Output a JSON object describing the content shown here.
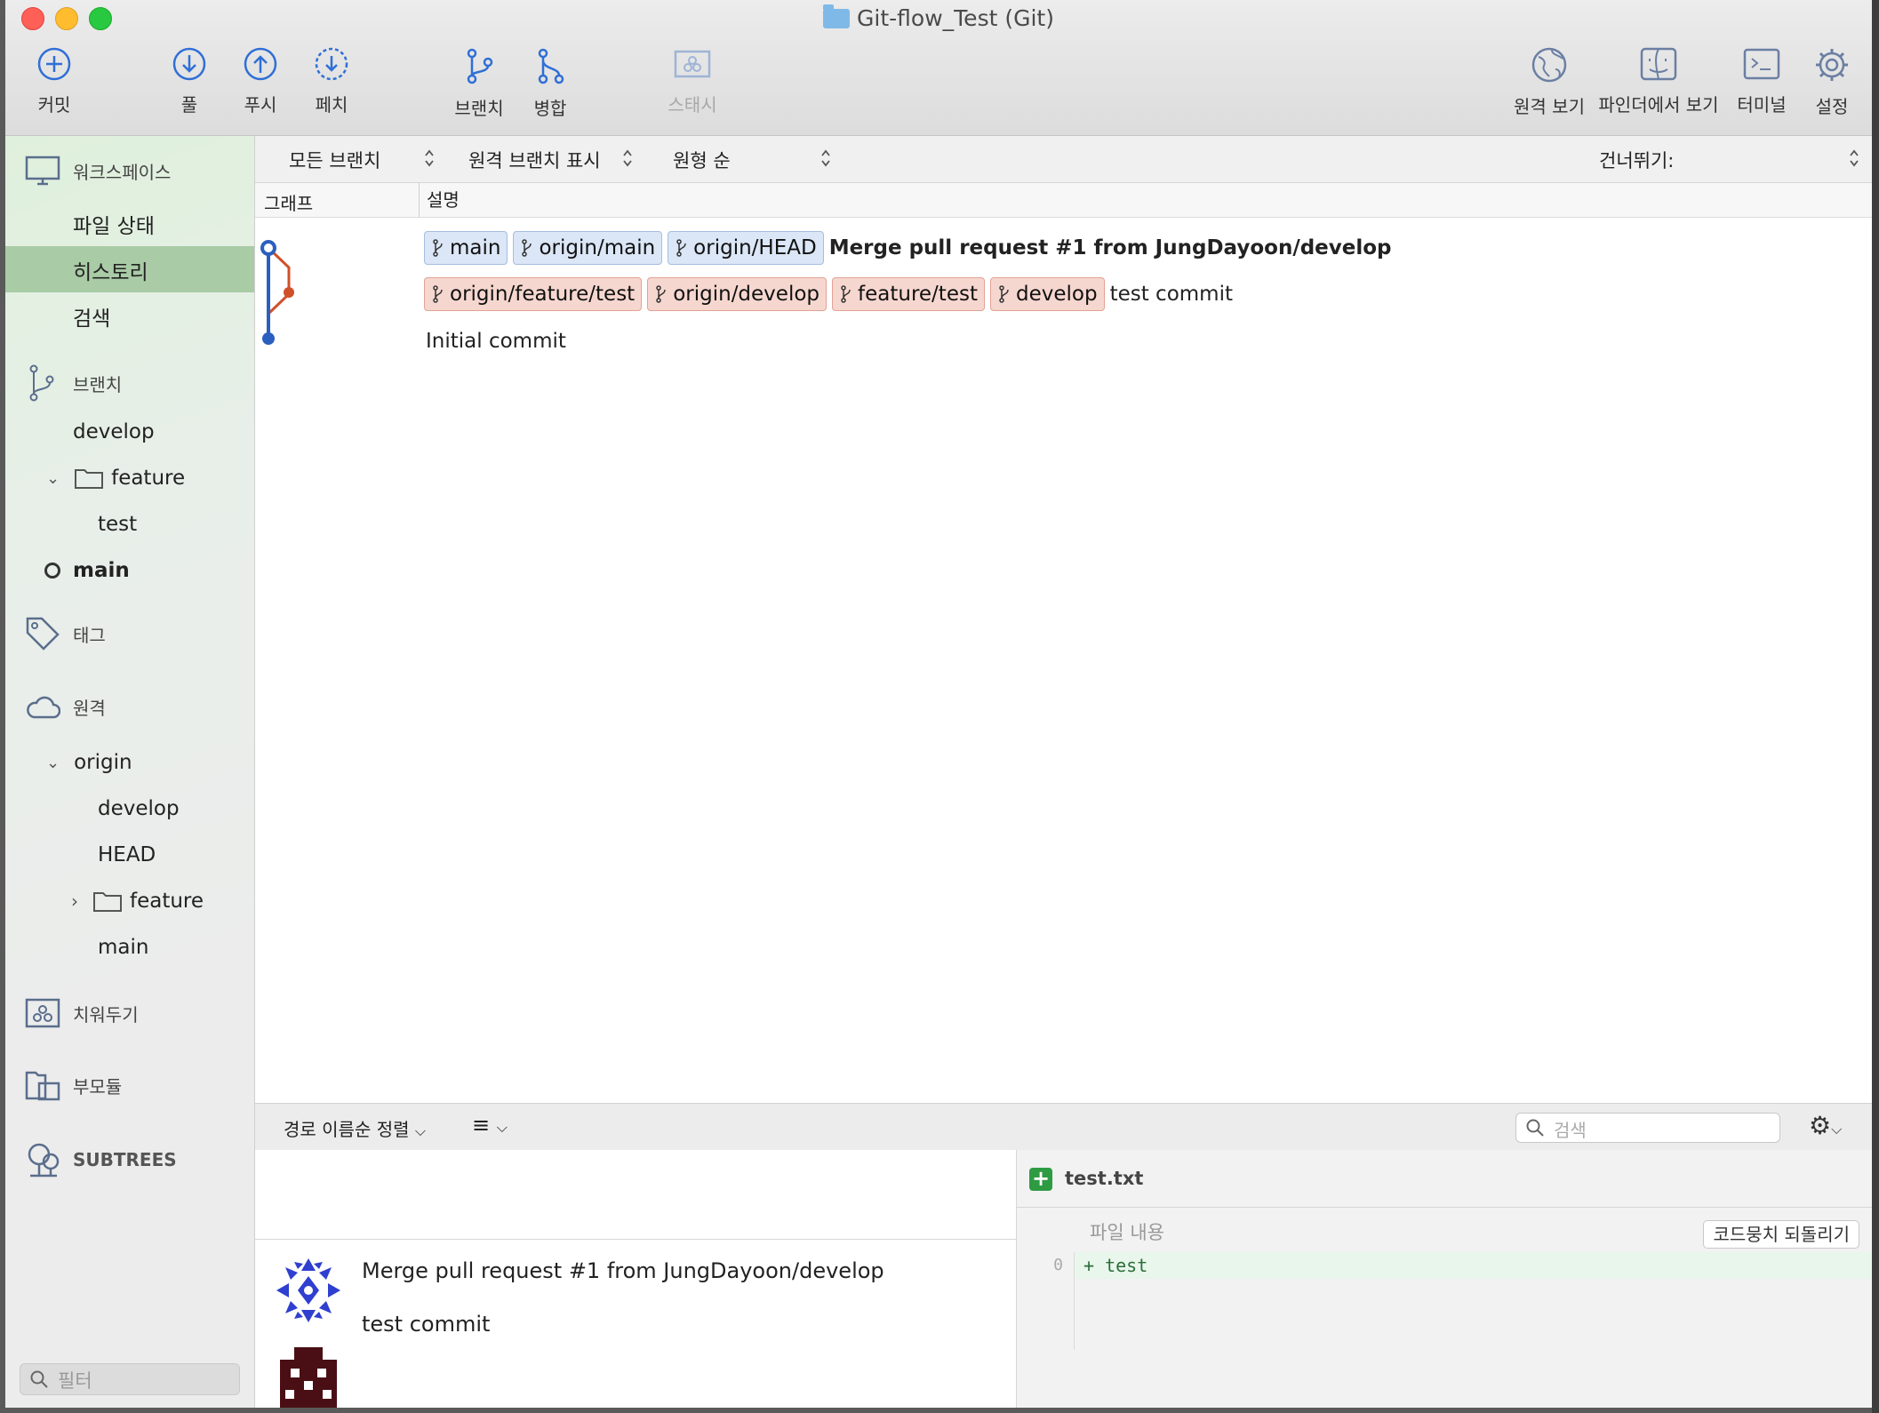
{
  "window": {
    "title": "Git-flow_Test (Git)"
  },
  "toolbar": {
    "commit": "커밋",
    "pull": "풀",
    "push": "푸시",
    "fetch": "페치",
    "branch": "브랜치",
    "merge": "병합",
    "stash": "스태시",
    "remote_view": "원격 보기",
    "finder_view": "파인더에서 보기",
    "terminal": "터미널",
    "settings": "설정"
  },
  "sidebar": {
    "workspace": {
      "title": "워크스페이스",
      "items": [
        "파일 상태",
        "히스토리",
        "검색"
      ],
      "selected": "히스토리"
    },
    "branches": {
      "title": "브랜치",
      "develop": "develop",
      "folder": "feature",
      "folder_child": "test",
      "current": "main"
    },
    "tags": {
      "title": "태그"
    },
    "remotes": {
      "title": "원격",
      "origin": "origin",
      "develop": "develop",
      "head": "HEAD",
      "folder": "feature",
      "main": "main"
    },
    "stashes": {
      "title": "치워두기"
    },
    "submodules": {
      "title": "부모듈"
    },
    "subtrees": {
      "title": "SUBTREES"
    },
    "filter_placeholder": "필터"
  },
  "filterbar": {
    "branches": "모든 브랜치",
    "remote": "원격 브랜치 표시",
    "order": "원형 순",
    "jump": "건너뛰기:"
  },
  "columns": {
    "graph": "그래프",
    "description": "설명"
  },
  "commits": [
    {
      "tags": [
        {
          "name": "main",
          "type": "local"
        },
        {
          "name": "origin/main",
          "type": "local"
        },
        {
          "name": "origin/HEAD",
          "type": "local"
        }
      ],
      "message": "Merge pull request #1 from JungDayoon/develop",
      "bold": true
    },
    {
      "tags": [
        {
          "name": "origin/feature/test",
          "type": "other"
        },
        {
          "name": "origin/develop",
          "type": "other"
        },
        {
          "name": "feature/test",
          "type": "other"
        },
        {
          "name": "develop",
          "type": "other"
        }
      ],
      "message": "test commit",
      "bold": false
    },
    {
      "tags": [],
      "message": "Initial commit",
      "bold": false
    }
  ],
  "bottom": {
    "sort": "경로 이름순 정렬",
    "search_placeholder": "검색"
  },
  "details": {
    "line1": "Merge pull request #1 from JungDayoon/develop",
    "line2": "test commit"
  },
  "diff": {
    "file": "test.txt",
    "hunk_title": "파일 내용",
    "discard": "코드뭉치 되돌리기",
    "line_no": "0",
    "line": "+ test"
  },
  "colors": {
    "graph_main": "#2b5fbf",
    "graph_branch": "#d0502a",
    "selected_bg": "#a9cba6"
  }
}
